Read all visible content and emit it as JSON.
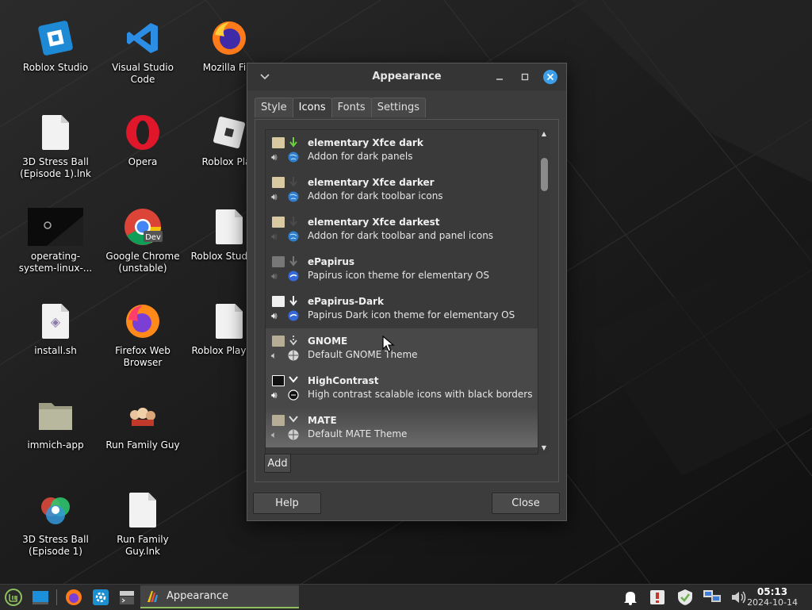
{
  "desktop": {
    "icons": [
      {
        "label": "Roblox Studio",
        "icon": "roblox-studio-icon"
      },
      {
        "label": "Visual Studio Code",
        "icon": "vscode-icon"
      },
      {
        "label": "Mozilla Fire",
        "icon": "firefox-icon"
      },
      {
        "label": "3D Stress Ball (Episode 1).lnk",
        "icon": "document-icon"
      },
      {
        "label": "Opera",
        "icon": "opera-icon"
      },
      {
        "label": "Roblox Play",
        "icon": "roblox-player-icon"
      },
      {
        "label": "operating-system-linux-...",
        "icon": "image-thumbnail-icon"
      },
      {
        "label": "Google Chrome (unstable)",
        "icon": "chrome-dev-icon",
        "badge": "Dev"
      },
      {
        "label": "Roblox Studio.ln",
        "icon": "document-icon"
      },
      {
        "label": "install.sh",
        "icon": "script-icon"
      },
      {
        "label": "Firefox Web Browser",
        "icon": "firefox-icon"
      },
      {
        "label": "Roblox Player.ln",
        "icon": "document-icon"
      },
      {
        "label": "immich-app",
        "icon": "folder-icon"
      },
      {
        "label": "Run Family Guy",
        "icon": "family-guy-icon"
      },
      {
        "label": "3D Stress Ball (Episode 1)",
        "icon": "stress-ball-icon"
      },
      {
        "label": "Run Family Guy.lnk",
        "icon": "document-icon"
      }
    ]
  },
  "window": {
    "title": "Appearance",
    "tabs": [
      "Style",
      "Icons",
      "Fonts",
      "Settings"
    ],
    "active_tab": "Icons",
    "icon_themes": [
      {
        "name": "elementary Xfce dark",
        "description": "Addon for dark panels"
      },
      {
        "name": "elementary Xfce darker",
        "description": "Addon for dark toolbar icons"
      },
      {
        "name": "elementary Xfce darkest",
        "description": "Addon for dark toolbar and panel icons"
      },
      {
        "name": "ePapirus",
        "description": "Papirus icon theme for elementary OS"
      },
      {
        "name": "ePapirus-Dark",
        "description": "Papirus Dark icon theme for elementary OS"
      },
      {
        "name": "GNOME",
        "description": "Default GNOME Theme"
      },
      {
        "name": "HighContrast",
        "description": "High contrast scalable icons with black borders"
      },
      {
        "name": "MATE",
        "description": "Default MATE Theme"
      }
    ],
    "add_label": "Add",
    "help_label": "Help",
    "close_label": "Close"
  },
  "taskbar": {
    "active_task": "Appearance",
    "clock_time": "05:13",
    "clock_date": "2024-10-14"
  },
  "colors": {
    "accent": "#8fbf5f",
    "close_button": "#3d9ee9",
    "window_bg": "#3c3c3c"
  }
}
